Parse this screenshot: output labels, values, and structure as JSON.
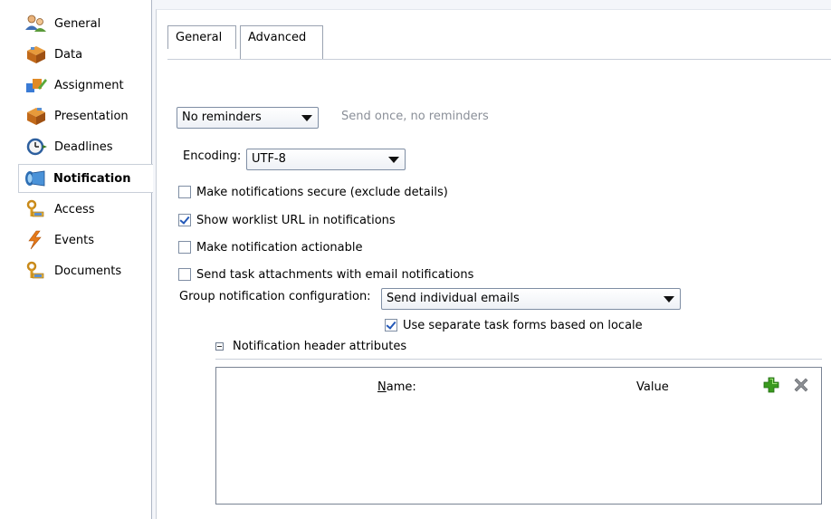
{
  "sidebar": {
    "items": [
      {
        "label": "General",
        "icon": "user-group-icon"
      },
      {
        "label": "Data",
        "icon": "data-cube-icon"
      },
      {
        "label": "Assignment",
        "icon": "assignment-icon"
      },
      {
        "label": "Presentation",
        "icon": "presentation-cube-icon"
      },
      {
        "label": "Deadlines",
        "icon": "clock-icon"
      },
      {
        "label": "Notification",
        "icon": "notification-speaker-icon",
        "selected": true
      },
      {
        "label": "Access",
        "icon": "key-icon"
      },
      {
        "label": "Events",
        "icon": "lightning-icon"
      },
      {
        "label": "Documents",
        "icon": "key-icon"
      }
    ]
  },
  "tabs": [
    {
      "label": "General",
      "active": false
    },
    {
      "label": "Advanced",
      "active": true
    }
  ],
  "reminders": {
    "selected": "No reminders",
    "hint": "Send once, no reminders"
  },
  "encoding": {
    "label": "Encoding:",
    "selected": "UTF-8"
  },
  "options": [
    {
      "label": "Make notifications secure (exclude details)",
      "checked": false
    },
    {
      "label": "Show worklist URL in notifications",
      "checked": true
    },
    {
      "label": "Make notification actionable",
      "checked": false
    },
    {
      "label": "Send task attachments with email notifications",
      "checked": false
    }
  ],
  "group_config": {
    "label": "Group notification configuration:",
    "selected": "Send individual emails",
    "locale_option": {
      "label": "Use separate task forms based on locale",
      "checked": true
    }
  },
  "header_attributes": {
    "title": "Notification header attributes",
    "columns": {
      "name_prefix": "",
      "name_mnemonic": "N",
      "name_rest": "ame:",
      "value": "Value"
    }
  },
  "colors": {
    "accent_green": "#3a9a1f",
    "delete_gray": "#8c8f94",
    "check_blue": "#2358b8"
  }
}
